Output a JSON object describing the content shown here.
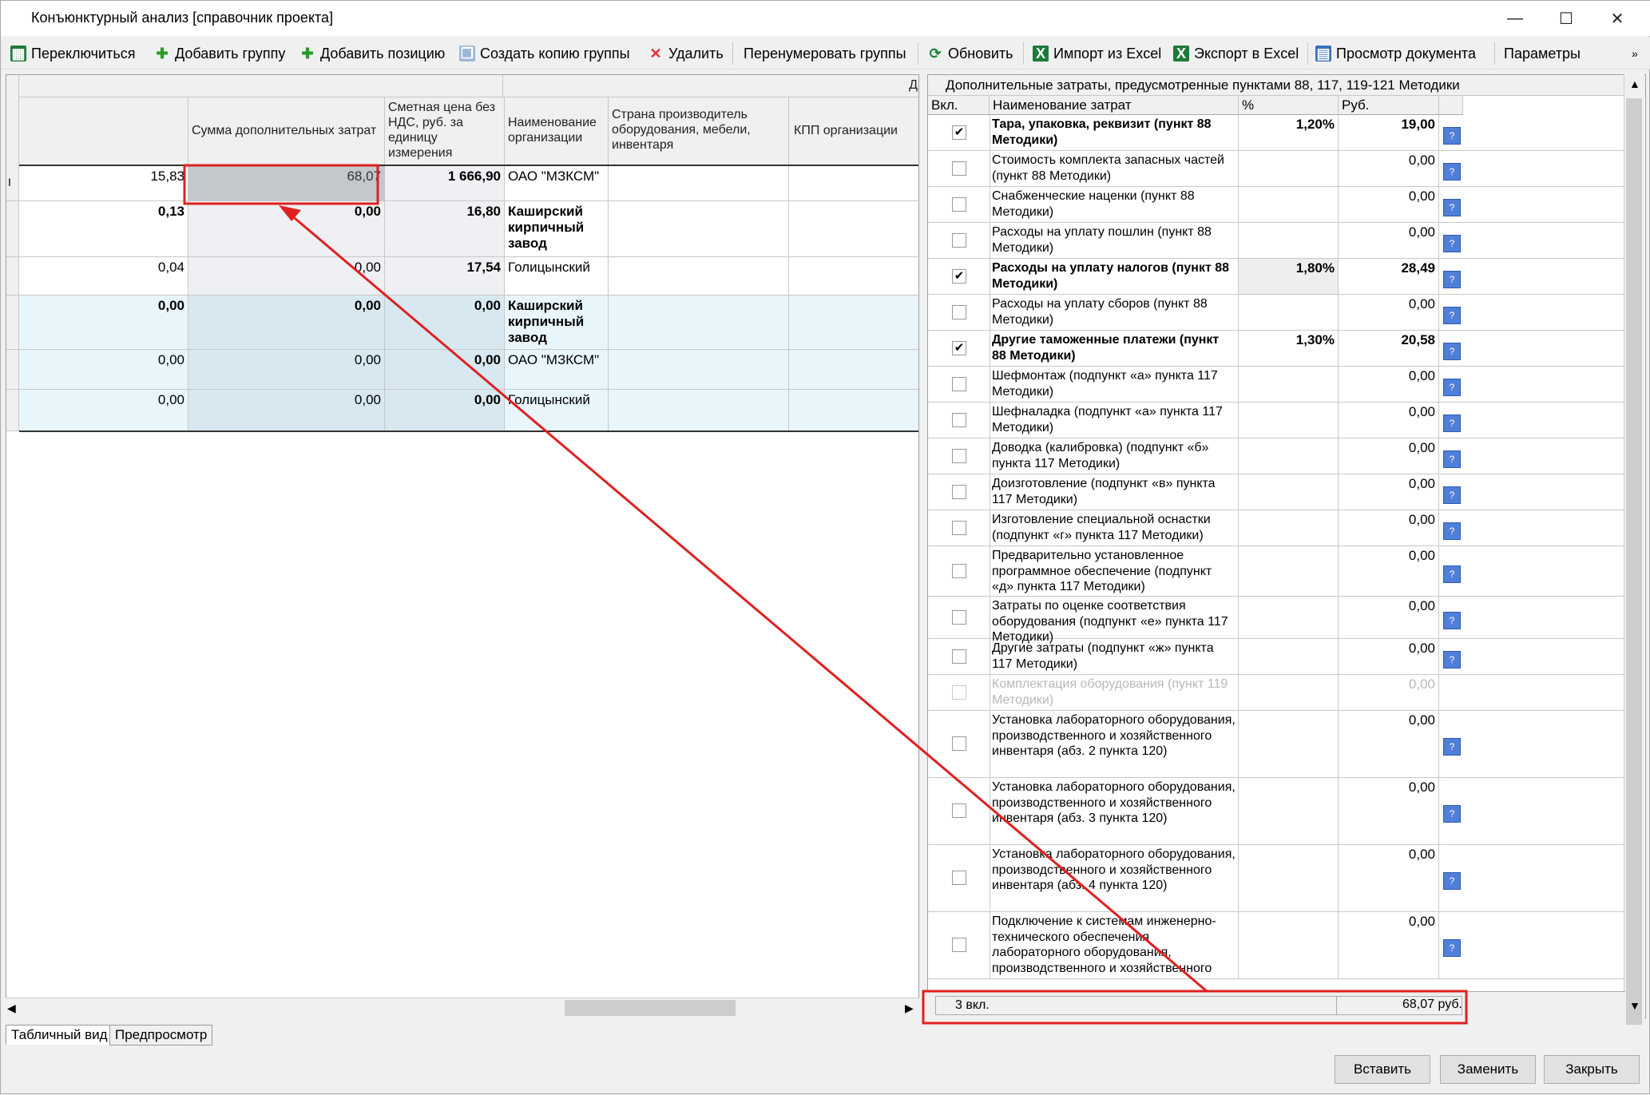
{
  "window": {
    "title": "Конъюнктурный анализ [справочник проекта]"
  },
  "toolbar": {
    "switch": "Переключиться",
    "add_group": "Добавить группу",
    "add_position": "Добавить позицию",
    "copy_group": "Создать копию группы",
    "delete": "Удалить",
    "renumber": "Перенумеровать группы",
    "refresh": "Обновить",
    "import_excel": "Импорт из Excel",
    "export_excel": "Экспорт в Excel",
    "view_doc": "Просмотр документа",
    "params": "Параметры"
  },
  "grid": {
    "top_marker": "Д",
    "headers": {
      "sum_add": "Сумма дополнительных затрат",
      "price": "Сметная цена без НДС, руб. за единицу измерения",
      "org": "Наименование организации",
      "country": "Страна производитель оборудования, мебели, инвентаря",
      "kpp": "КПП организации"
    },
    "rows": [
      {
        "c1": "15,83",
        "sum": "68,07",
        "price": "1 666,90",
        "org": "ОАО \"МЗКСМ\""
      },
      {
        "c1": "0,13",
        "sum": "0,00",
        "price": "16,80",
        "org": "Каширский кирпичный завод"
      },
      {
        "c1": "0,04",
        "sum": "0,00",
        "price": "17,54",
        "org": "Голицынский"
      },
      {
        "c1": "0,00",
        "sum": "0,00",
        "price": "0,00",
        "org": "Каширский кирпичный завод"
      },
      {
        "c1": "0,00",
        "sum": "0,00",
        "price": "0,00",
        "org": "ОАО \"МЗКСМ\""
      },
      {
        "c1": "0,00",
        "sum": "0,00",
        "price": "0,00",
        "org": "Голицынский"
      }
    ]
  },
  "tabs": {
    "table": "Табличный вид",
    "preview": "Предпросмотр"
  },
  "panel": {
    "title": "Дополнительные затраты, предусмотренные пунктами 88, 117, 119-121 Методики",
    "col_on": "Вкл.",
    "col_name": "Наименование затрат",
    "col_pct": "%",
    "col_rub": "Руб.",
    "items": [
      {
        "name": "Тара, упаковка, реквизит (пункт 88 Методики)",
        "pct": "1,20%",
        "rub": "19,00",
        "checked": true
      },
      {
        "name": "Стоимость комплекта запасных частей (пункт 88 Методики)",
        "pct": "",
        "rub": "0,00",
        "checked": false
      },
      {
        "name": "Снабженческие наценки (пункт 88 Методики)",
        "pct": "",
        "rub": "0,00",
        "checked": false
      },
      {
        "name": "Расходы на уплату пошлин (пункт 88 Методики)",
        "pct": "",
        "rub": "0,00",
        "checked": false
      },
      {
        "name": "Расходы на уплату налогов (пункт 88 Методики)",
        "pct": "1,80%",
        "rub": "28,49",
        "checked": true
      },
      {
        "name": "Расходы на уплату сборов (пункт 88 Методики)",
        "pct": "",
        "rub": "0,00",
        "checked": false
      },
      {
        "name": "Другие таможенные платежи (пункт 88 Методики)",
        "pct": "1,30%",
        "rub": "20,58",
        "checked": true
      },
      {
        "name": "Шефмонтаж (подпункт «а» пункта 117 Методики)",
        "pct": "",
        "rub": "0,00",
        "checked": false
      },
      {
        "name": "Шефналадка (подпункт «а» пункта 117 Методики)",
        "pct": "",
        "rub": "0,00",
        "checked": false
      },
      {
        "name": "Доводка (калибровка) (подпункт «б» пункта 117 Методики)",
        "pct": "",
        "rub": "0,00",
        "checked": false
      },
      {
        "name": "Доизготовление (подпункт «в» пункта 117 Методики)",
        "pct": "",
        "rub": "0,00",
        "checked": false
      },
      {
        "name": "Изготовление специальной оснастки (подпункт «г» пункта 117 Методики)",
        "pct": "",
        "rub": "0,00",
        "checked": false
      },
      {
        "name": "Предварительно установленное программное обеспечение (подпункт «д» пункта 117 Методики)",
        "pct": "",
        "rub": "0,00",
        "checked": false
      },
      {
        "name": "Затраты по оценке соответствия оборудования (подпункт «е» пункта 117 Методики)",
        "pct": "",
        "rub": "0,00",
        "checked": false
      },
      {
        "name": "Другие затраты (подпункт «ж» пункта 117 Методики)",
        "pct": "",
        "rub": "0,00",
        "checked": false
      },
      {
        "name": "Комплектация оборудования (пункт 119 Методики)",
        "pct": "",
        "rub": "0,00",
        "checked": false
      },
      {
        "name": "Установка лабораторного оборудования, производственного и хозяйственного инвентаря (абз. 2 пункта 120)",
        "pct": "",
        "rub": "0,00",
        "checked": false
      },
      {
        "name": "Установка лабораторного оборудования, производственного и хозяйственного инвентаря (абз. 3 пункта 120)",
        "pct": "",
        "rub": "0,00",
        "checked": false
      },
      {
        "name": "Установка лабораторного оборудования, производственного и хозяйственного инвентаря (абз. 4 пункта 120)",
        "pct": "",
        "rub": "0,00",
        "checked": false
      },
      {
        "name": "Подключение к системам инженерно-технического обеспечения лабораторного оборудования, производственного и хозяйственного",
        "pct": "",
        "rub": "0,00",
        "checked": false
      }
    ],
    "footer_count": "3 вкл.",
    "footer_total": "68,07 руб.",
    "help_glyph": "?"
  },
  "buttons": {
    "insert": "Вставить",
    "replace": "Заменить",
    "close": "Закрыть"
  },
  "annotation_color": "#e02020"
}
